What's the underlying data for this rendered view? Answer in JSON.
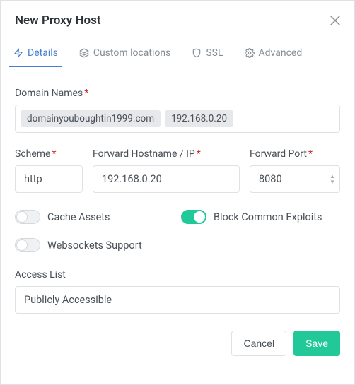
{
  "header": {
    "title": "New Proxy Host"
  },
  "tabs": {
    "details": "Details",
    "custom_locations": "Custom locations",
    "ssl": "SSL",
    "advanced": "Advanced"
  },
  "labels": {
    "domain_names": "Domain Names",
    "scheme": "Scheme",
    "forward_host": "Forward Hostname / IP",
    "forward_port": "Forward Port",
    "cache_assets": "Cache Assets",
    "block_exploits": "Block Common Exploits",
    "websockets": "Websockets Support",
    "access_list": "Access List"
  },
  "values": {
    "chips": [
      "domainyouboughtin1999.com",
      "192.168.0.20"
    ],
    "scheme": "http",
    "forward_host": "192.168.0.20",
    "forward_port": "8080",
    "access_list": "Publicly Accessible"
  },
  "toggles": {
    "cache_assets": false,
    "block_exploits": true,
    "websockets": false
  },
  "buttons": {
    "cancel": "Cancel",
    "save": "Save"
  },
  "colors": {
    "accent_blue": "#467fcf",
    "accent_teal": "#20c997",
    "required_red": "#cd201f"
  }
}
